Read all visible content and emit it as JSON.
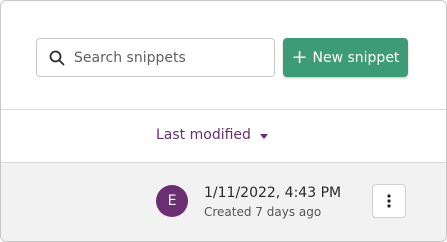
{
  "toolbar": {
    "search": {
      "placeholder": "Search snippets",
      "value": "",
      "icon": "search-icon"
    },
    "new_snippet_button": {
      "icon": "plus-icon",
      "icon_glyph": "+",
      "label": "New snippet"
    }
  },
  "sort": {
    "label": "Last modified",
    "icon": "caret-down-icon"
  },
  "snippets": [
    {
      "avatar_initial": "E",
      "modified": "1/11/2022, 4:43 PM",
      "created": "Created 7 days ago",
      "menu_icon": "more-vertical-icon"
    }
  ],
  "colors": {
    "accent_purple": "#6b2e72",
    "primary_green": "#3e9b77",
    "row_background": "#f2f2f2",
    "divider": "#d9d9d9"
  }
}
